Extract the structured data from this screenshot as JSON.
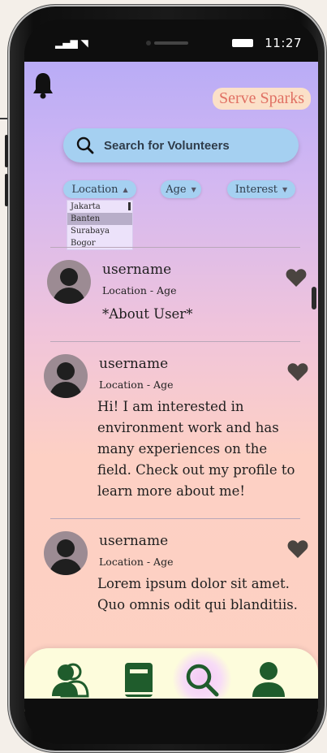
{
  "status_bar": {
    "time": "11:27"
  },
  "app": {
    "brand": "Serve Sparks"
  },
  "search": {
    "placeholder": "Search for Volunteers"
  },
  "filters": [
    {
      "label": "Location",
      "arrow": "▲"
    },
    {
      "label": "Age",
      "arrow": "▼"
    },
    {
      "label": "Interest",
      "arrow": "▼"
    }
  ],
  "location_options": [
    "Jakarta",
    "Banten",
    "Surabaya",
    "Bogor"
  ],
  "location_selected": "Banten",
  "users": [
    {
      "username": "username",
      "meta": "Location - Age",
      "about": "*About User*"
    },
    {
      "username": "username",
      "meta": "Location - Age",
      "about": "Hi! I am interested in environment work and has many experiences on the field. Check out my profile to learn more about me!"
    },
    {
      "username": "username",
      "meta": "Location - Age",
      "about": "Lorem ipsum dolor sit amet. Quo omnis odit qui blanditiis."
    }
  ],
  "icons": {
    "bell": "bell-icon",
    "search": "search-icon",
    "heart": "heart-icon",
    "nav": [
      "contacts-icon",
      "book-icon",
      "search-icon",
      "profile-icon"
    ]
  },
  "colors": {
    "accent": "#a5d0f1",
    "brand": "#e07063",
    "nav_icon": "#1f5c2c",
    "heart": "#4a4440"
  }
}
